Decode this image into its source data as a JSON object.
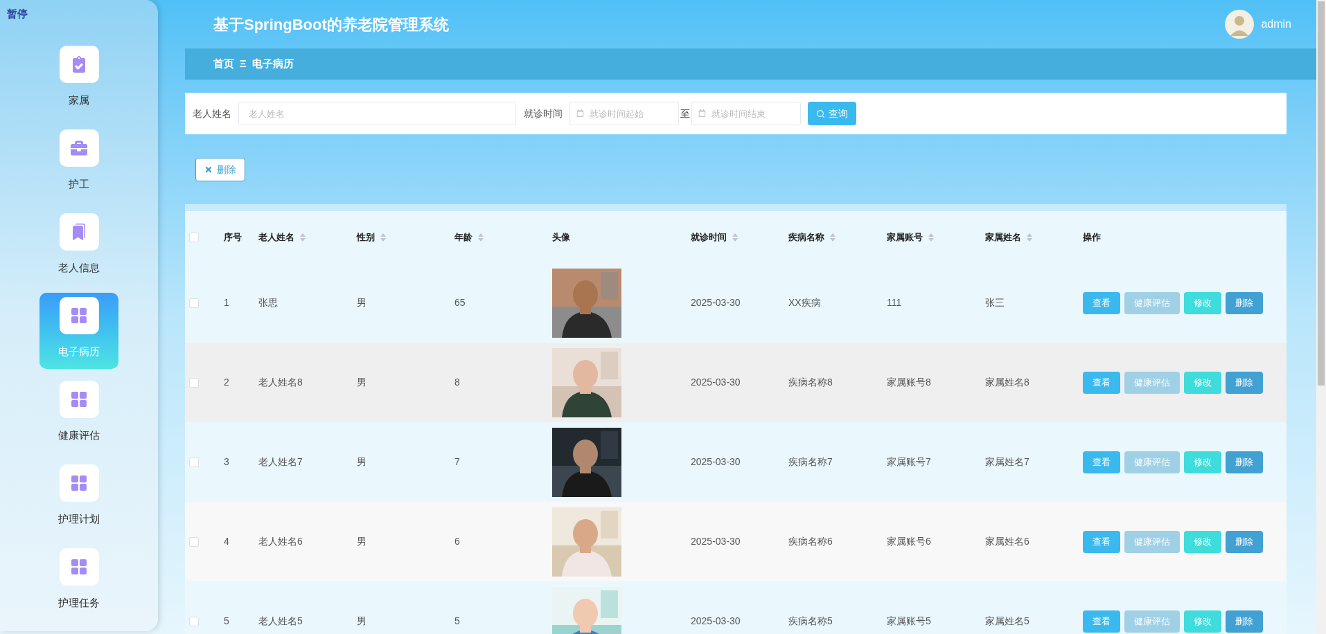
{
  "overlay_label": "暂停",
  "sidebar": {
    "items": [
      {
        "label": "家属",
        "kind": "clipboard",
        "selected": false
      },
      {
        "label": "护工",
        "kind": "briefcase",
        "selected": false
      },
      {
        "label": "老人信息",
        "kind": "book",
        "selected": false
      },
      {
        "label": "电子病历",
        "kind": "grid",
        "selected": true
      },
      {
        "label": "健康评估",
        "kind": "grid",
        "selected": false
      },
      {
        "label": "护理计划",
        "kind": "grid",
        "selected": false
      },
      {
        "label": "护理任务",
        "kind": "grid",
        "selected": false
      }
    ]
  },
  "header": {
    "title": "基于SpringBoot的养老院管理系统",
    "user": "admin"
  },
  "breadcrumb": {
    "items": [
      "首页",
      "电子病历"
    ],
    "separator": "Ξ"
  },
  "search": {
    "name_label": "老人姓名",
    "name_placeholder": "老人姓名",
    "date_label": "就诊时间",
    "date_from_placeholder": "就诊时间起始",
    "date_to_label": "至",
    "date_to_placeholder": "就诊时间结束",
    "button": "查询"
  },
  "toolbar": {
    "delete_button": "删除"
  },
  "table": {
    "select_all_checked": false,
    "columns": [
      {
        "label": "序号",
        "sortable": false
      },
      {
        "label": "老人姓名",
        "sortable": true
      },
      {
        "label": "性别",
        "sortable": true
      },
      {
        "label": "年龄",
        "sortable": true
      },
      {
        "label": "头像",
        "sortable": false
      },
      {
        "label": "就诊时间",
        "sortable": true
      },
      {
        "label": "疾病名称",
        "sortable": true
      },
      {
        "label": "家属账号",
        "sortable": true
      },
      {
        "label": "家属姓名",
        "sortable": true
      },
      {
        "label": "操作",
        "sortable": false
      }
    ],
    "rows": [
      {
        "index": "1",
        "name": "张思",
        "gender": "男",
        "age": "65",
        "avatar": {
          "kind": "picture"
        },
        "date": "2025-03-30",
        "disease": "XX疾病",
        "family_account": "111",
        "family_name": "张三",
        "checked": false,
        "actions": [
          "查看",
          "健康评估",
          "修改",
          "删除"
        ]
      },
      {
        "index": "2",
        "name": "老人姓名8",
        "gender": "男",
        "age": "8",
        "avatar": {
          "kind": "picture"
        },
        "date": "2025-03-30",
        "disease": "疾病名称8",
        "family_account": "家属账号8",
        "family_name": "家属姓名8",
        "checked": false,
        "actions": [
          "查看",
          "健康评估",
          "修改",
          "删除"
        ]
      },
      {
        "index": "3",
        "name": "老人姓名7",
        "gender": "男",
        "age": "7",
        "avatar": {
          "kind": "picture"
        },
        "date": "2025-03-30",
        "disease": "疾病名称7",
        "family_account": "家属账号7",
        "family_name": "家属姓名7",
        "checked": false,
        "actions": [
          "查看",
          "健康评估",
          "修改",
          "删除"
        ]
      },
      {
        "index": "4",
        "name": "老人姓名6",
        "gender": "男",
        "age": "6",
        "avatar": {
          "kind": "picture"
        },
        "date": "2025-03-30",
        "disease": "疾病名称6",
        "family_account": "家属账号6",
        "family_name": "家属姓名6",
        "checked": false,
        "actions": [
          "查看",
          "健康评估",
          "修改",
          "删除"
        ]
      },
      {
        "index": "5",
        "name": "老人姓名5",
        "gender": "男",
        "age": "5",
        "avatar": {
          "kind": "picture"
        },
        "date": "2025-03-30",
        "disease": "疾病名称5",
        "family_account": "家属账号5",
        "family_name": "家属姓名5",
        "checked": false,
        "actions": [
          "查看",
          "健康评估",
          "修改",
          "删除"
        ]
      }
    ]
  }
}
